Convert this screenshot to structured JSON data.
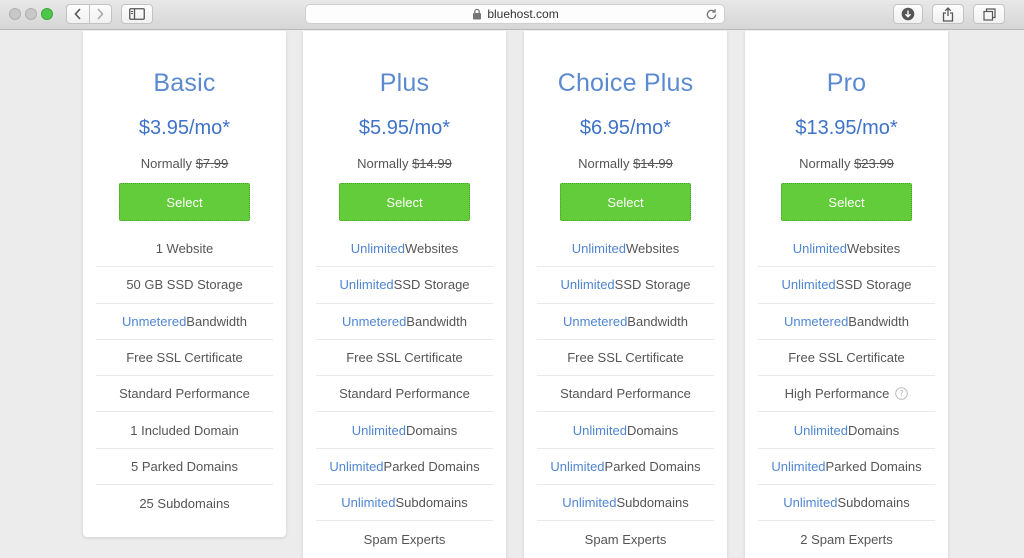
{
  "browser": {
    "url": "bluehost.com",
    "icons": {
      "back": "chevron-left-icon",
      "forward": "chevron-right-icon",
      "sidebar": "sidebar-icon",
      "lock": "lock-icon",
      "reload": "reload-icon",
      "download": "download-icon",
      "share": "share-icon",
      "tabs": "tabs-icon"
    }
  },
  "colors": {
    "plan_name": "#5b8ad0",
    "price": "#3f73c8",
    "highlight": "#4f85d1",
    "select_button": "#63cc3a",
    "text": "#555555"
  },
  "plans": [
    {
      "name": "Basic",
      "price": "$3.95/mo*",
      "normally_label": "Normally",
      "normally_price": "$7.99",
      "select_label": "Select",
      "features": [
        {
          "hl": "",
          "text": "1 Website"
        },
        {
          "hl": "",
          "text": "50 GB SSD Storage"
        },
        {
          "hl": "Unmetered",
          "text": " Bandwidth"
        },
        {
          "hl": "",
          "text": "Free SSL Certificate"
        },
        {
          "hl": "",
          "text": "Standard Performance"
        },
        {
          "hl": "",
          "text": "1 Included Domain"
        },
        {
          "hl": "",
          "text": "5 Parked Domains"
        },
        {
          "hl": "",
          "text": "25 Subdomains"
        }
      ]
    },
    {
      "name": "Plus",
      "price": "$5.95/mo*",
      "normally_label": "Normally",
      "normally_price": "$14.99",
      "select_label": "Select",
      "features": [
        {
          "hl": "Unlimited",
          "text": " Websites"
        },
        {
          "hl": "Unlimited",
          "text": " SSD Storage"
        },
        {
          "hl": "Unmetered",
          "text": " Bandwidth"
        },
        {
          "hl": "",
          "text": "Free SSL Certificate"
        },
        {
          "hl": "",
          "text": "Standard Performance"
        },
        {
          "hl": "Unlimited",
          "text": " Domains"
        },
        {
          "hl": "Unlimited",
          "text": " Parked Domains"
        },
        {
          "hl": "Unlimited",
          "text": " Subdomains"
        },
        {
          "hl": "",
          "text": "Spam Experts"
        }
      ]
    },
    {
      "name": "Choice Plus",
      "price": "$6.95/mo*",
      "normally_label": "Normally",
      "normally_price": "$14.99",
      "select_label": "Select",
      "features": [
        {
          "hl": "Unlimited",
          "text": " Websites"
        },
        {
          "hl": "Unlimited",
          "text": " SSD Storage"
        },
        {
          "hl": "Unmetered",
          "text": " Bandwidth"
        },
        {
          "hl": "",
          "text": "Free SSL Certificate"
        },
        {
          "hl": "",
          "text": "Standard Performance"
        },
        {
          "hl": "Unlimited",
          "text": " Domains"
        },
        {
          "hl": "Unlimited",
          "text": " Parked Domains"
        },
        {
          "hl": "Unlimited",
          "text": " Subdomains"
        },
        {
          "hl": "",
          "text": "Spam Experts"
        }
      ]
    },
    {
      "name": "Pro",
      "price": "$13.95/mo*",
      "normally_label": "Normally",
      "normally_price": "$23.99",
      "select_label": "Select",
      "features": [
        {
          "hl": "Unlimited",
          "text": " Websites"
        },
        {
          "hl": "Unlimited",
          "text": " SSD Storage"
        },
        {
          "hl": "Unmetered",
          "text": " Bandwidth"
        },
        {
          "hl": "",
          "text": "Free SSL Certificate"
        },
        {
          "hl": "",
          "text": "High Performance",
          "help_icon": "help-circle-icon"
        },
        {
          "hl": "Unlimited",
          "text": " Domains"
        },
        {
          "hl": "Unlimited",
          "text": " Parked Domains"
        },
        {
          "hl": "Unlimited",
          "text": " Subdomains"
        },
        {
          "hl": "",
          "text": "2 Spam Experts"
        }
      ]
    }
  ]
}
